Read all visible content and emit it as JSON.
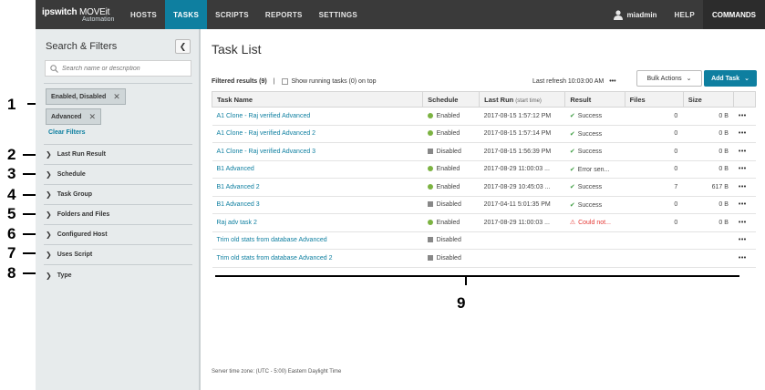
{
  "callouts": [
    "1",
    "2",
    "3",
    "4",
    "5",
    "6",
    "7",
    "8",
    "9"
  ],
  "nav": {
    "brand_a": "ipswitch",
    "brand_b": "MOVEit",
    "brand_sub": "Automation",
    "items": [
      "HOSTS",
      "TASKS",
      "SCRIPTS",
      "REPORTS",
      "SETTINGS"
    ],
    "active": "TASKS",
    "user": "miadmin",
    "help": "HELP",
    "commands": "COMMANDS"
  },
  "sidebar": {
    "title": "Search & Filters",
    "search_placeholder": "Search name or description",
    "chips": [
      "Enabled, Disabled",
      "Advanced"
    ],
    "clear": "Clear Filters",
    "facets": [
      "Last Run Result",
      "Schedule",
      "Task Group",
      "Folders and Files",
      "Configured Host",
      "Uses Script",
      "Type"
    ]
  },
  "main": {
    "title": "Task List",
    "filtered": "Filtered results (9)",
    "separator": "|",
    "running": "Show running tasks (0) on top",
    "refresh": "Last refresh 10:03:00 AM",
    "bulk": "Bulk Actions",
    "add": "Add Task",
    "columns": {
      "name": "Task Name",
      "schedule": "Schedule",
      "lastrun": "Last Run",
      "lastrun_sub": "(start time)",
      "result": "Result",
      "files": "Files",
      "size": "Size"
    },
    "rows": [
      {
        "name": "A1 Clone - Raj verified Advanced",
        "schedule": "Enabled",
        "lastrun": "2017-08-15 1:57:12 PM",
        "result": "Success",
        "files": "0",
        "size": "0 B"
      },
      {
        "name": "A1 Clone - Raj verified Advanced 2",
        "schedule": "Enabled",
        "lastrun": "2017-08-15 1:57:14 PM",
        "result": "Success",
        "files": "0",
        "size": "0 B"
      },
      {
        "name": "A1 Clone - Raj verified Advanced 3",
        "schedule": "Disabled",
        "lastrun": "2017-08-15 1:56:39 PM",
        "result": "Success",
        "files": "0",
        "size": "0 B"
      },
      {
        "name": "B1 Advanced",
        "schedule": "Enabled",
        "lastrun": "2017-08-29 11:00:03 ...",
        "result": "Error sen...",
        "files": "0",
        "size": "0 B"
      },
      {
        "name": "B1 Advanced 2",
        "schedule": "Enabled",
        "lastrun": "2017-08-29 10:45:03 ...",
        "result": "Success",
        "files": "7",
        "size": "617 B"
      },
      {
        "name": "B1 Advanced 3",
        "schedule": "Disabled",
        "lastrun": "2017-04-11 5:01:35 PM",
        "result": "Success",
        "files": "0",
        "size": "0 B"
      },
      {
        "name": "Raj adv task 2",
        "schedule": "Enabled",
        "lastrun": "2017-08-29 11:00:03 ...",
        "result": "Could not...",
        "files": "0",
        "size": "0 B"
      },
      {
        "name": "Trim old stats from database Advanced",
        "schedule": "Disabled",
        "lastrun": "",
        "result": "",
        "files": "",
        "size": ""
      },
      {
        "name": "Trim old stats from database Advanced 2",
        "schedule": "Disabled",
        "lastrun": "",
        "result": "",
        "files": "",
        "size": ""
      }
    ],
    "row_menu": "•••",
    "timezone": "Server time zone: (UTC - 5:00) Eastern Daylight Time"
  },
  "colors": {
    "accent": "#0e7fa0",
    "nav_bg": "#3a3a3a",
    "sidebar_bg": "#e7ebec",
    "enabled": "#7cb342",
    "disabled": "#888888",
    "error": "#e53935"
  }
}
